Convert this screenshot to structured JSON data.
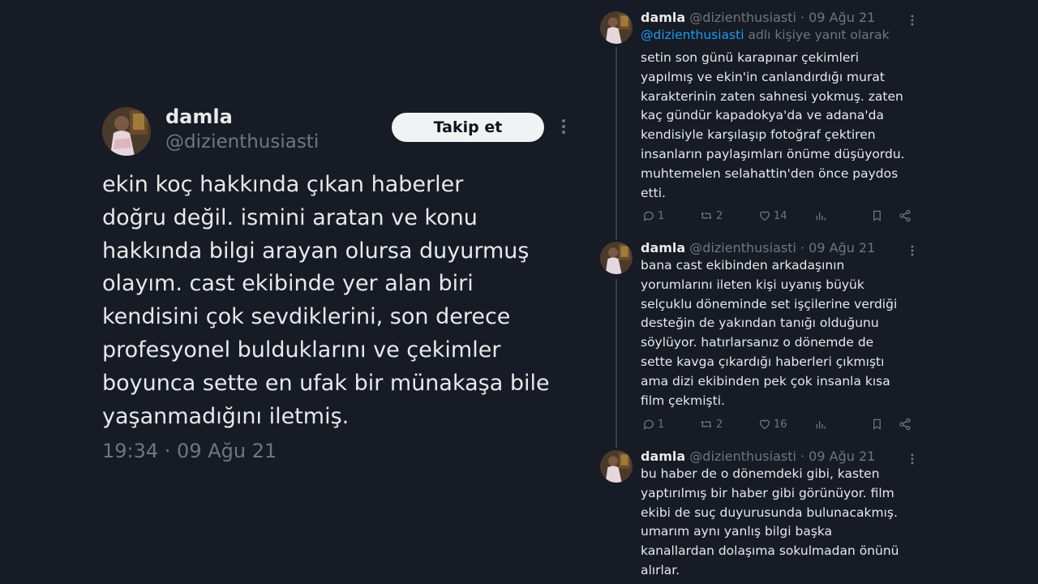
{
  "main_tweet": {
    "name": "damla",
    "handle": "@dizienthusiasti",
    "follow_label": "Takip et",
    "text": "ekin koç hakkında çıkan haberler\ndoğru değil. ismini aratan ve konu\nhakkında bilgi arayan olursa duyurmuş\nolayım. cast ekibinde yer alan biri\nkendisini çok sevdiklerini, son derece\nprofesyonel bulduklarını ve çekimler\nboyunca sette en ufak bir münakaşa bile\nyaşanmadığını iletmiş.",
    "time": "19:34 · 09 Ağu 21",
    "more_icon": "more-vertical-icon"
  },
  "replies": [
    {
      "name": "damla",
      "meta": "@dizienthusiasti · 09 Ağu 21",
      "reply_to_handle": "@dizienthusiasti",
      "reply_to_suffix": " adlı kişiye yanıt olarak",
      "text": "setin son günü karapınar çekimleri\nyapılmış ve ekin'in canlandırdığı murat\nkarakterinin zaten sahnesi yokmuş. zaten\nkaç gündür kapadokya'da ve adana'da\nkendisiyle karşılaşıp fotoğraf çektiren\ninsanların paylaşımları önüme düşüyordu.\nmuhtemelen selahattin'den önce paydos\netti.",
      "replies": "1",
      "retweets": "2",
      "likes": "14"
    },
    {
      "name": "damla",
      "meta": "@dizienthusiasti · 09 Ağu 21",
      "text": "bana cast ekibinden arkadaşının\nyorumlarını ileten kişi uyanış büyük\nselçuklu döneminde set işçilerine verdiği\ndesteğin de yakından tanığı olduğunu\nsöylüyor. hatırlarsanız o dönemde de\nsette kavga çıkardığı haberleri çıkmıştı\nama dizi ekibinden pek çok insanla kısa\nfilm çekmişti.",
      "replies": "1",
      "retweets": "2",
      "likes": "16"
    },
    {
      "name": "damla",
      "meta": "@dizienthusiasti · 09 Ağu 21",
      "text": "bu haber de o dönemdeki gibi, kasten\nyaptırılmış bir haber gibi görünüyor. film\nekibi de suç duyurusunda bulunacakmış.\numarım aynı yanlış bilgi başka\nkanallardan dolaşıma sokulmadan önünü\nalırlar."
    }
  ],
  "colors": {
    "background": "#161b25",
    "text": "#e7e9ea",
    "muted": "#71767b",
    "link": "#1d9bf0"
  }
}
